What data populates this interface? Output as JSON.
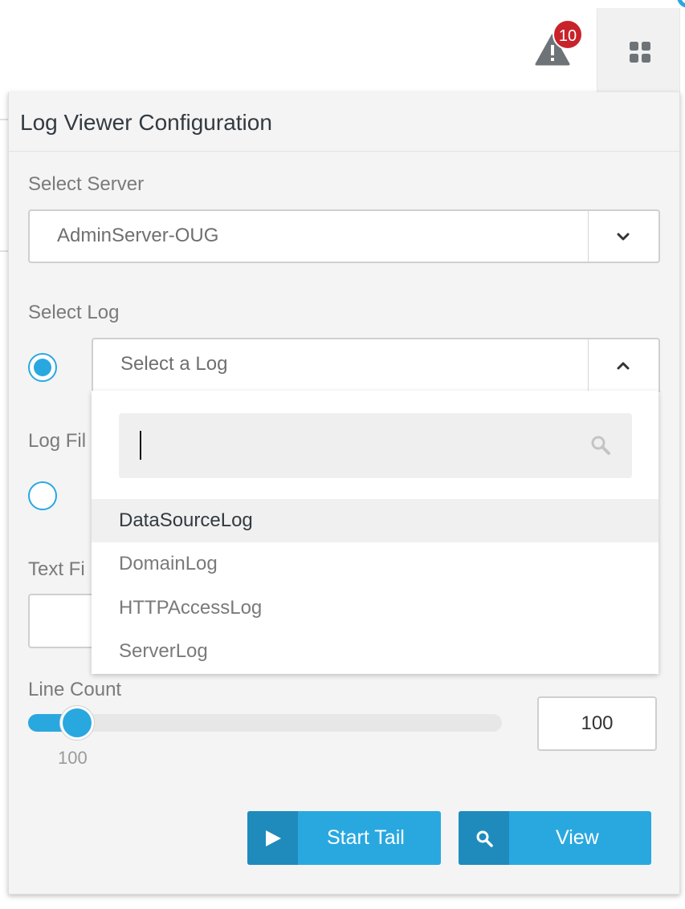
{
  "topbar": {
    "alert_count": "10",
    "alert_icon": "warning-triangle-icon",
    "menu_icon": "grid-icon"
  },
  "panel": {
    "title": "Log Viewer Configuration",
    "server": {
      "label": "Select Server",
      "value": "AdminServer-OUG"
    },
    "log": {
      "label": "Select Log",
      "placeholder": "Select a Log",
      "selected_radio": true
    },
    "log_file": {
      "label_visible": "Log Fil"
    },
    "text_filter": {
      "label_visible": "Text Fi"
    },
    "dropdown": {
      "search_value": "",
      "items": [
        "DataSourceLog",
        "DomainLog",
        "HTTPAccessLog",
        "ServerLog"
      ],
      "highlighted_index": 0
    },
    "line_count": {
      "label": "Line Count",
      "slider_value": "100",
      "input_value": "100",
      "slider_fraction": 0.1
    },
    "buttons": {
      "start_tail": "Start Tail",
      "view": "View"
    }
  },
  "colors": {
    "accent": "#29a8e0",
    "accent_dark": "#1f8bbd",
    "badge": "#c8232b",
    "panel_bg": "#f4f4f4"
  }
}
